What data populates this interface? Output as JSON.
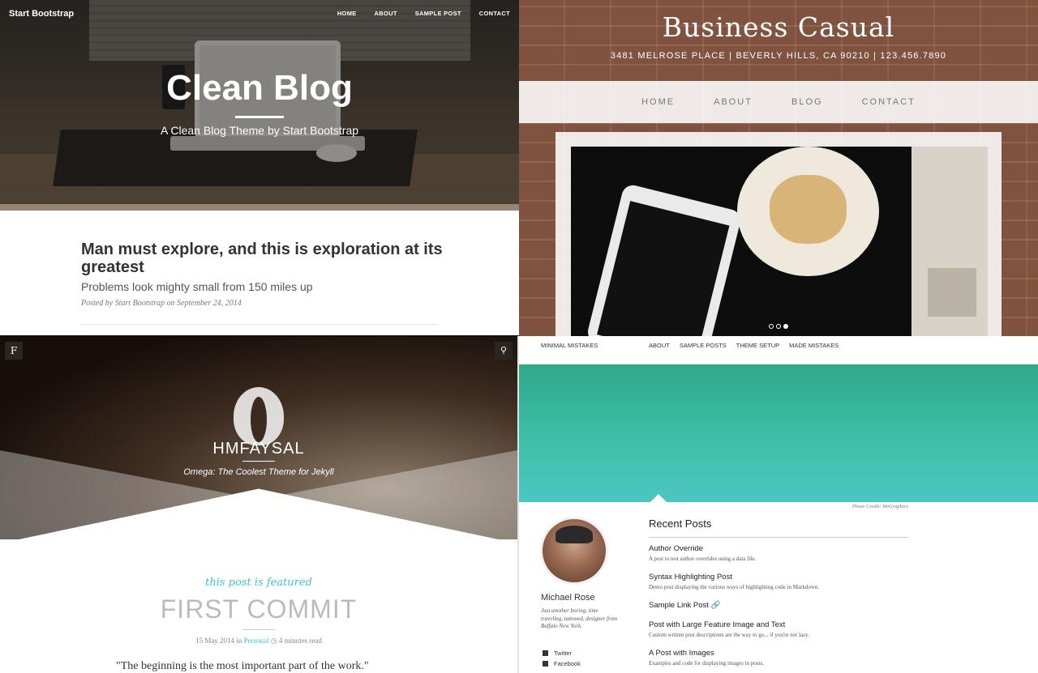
{
  "clean_blog": {
    "brand": "Start Bootstrap",
    "nav": [
      "HOME",
      "ABOUT",
      "SAMPLE POST",
      "CONTACT"
    ],
    "title": "Clean Blog",
    "subtitle": "A Clean Blog Theme by Start Bootstrap",
    "post": {
      "title": "Man must explore, and this is exploration at its greatest",
      "subtitle": "Problems look mighty small from 150 miles up",
      "meta": "Posted by Start Bootstrap on September 24, 2014"
    }
  },
  "business_casual": {
    "name": "Business Casual",
    "address": "3481 MELROSE PLACE | BEVERLY HILLS, CA 90210 | 123.456.7890",
    "nav": [
      "HOME",
      "ABOUT",
      "BLOG",
      "CONTACT"
    ],
    "carousel": {
      "slides": 3,
      "active": 3
    }
  },
  "hmfaysal": {
    "menu_button": "F",
    "search_icon": "search-icon",
    "site_name": "HMFAYSAL",
    "tagline": "Omega: The Coolest Theme for Jekyll",
    "featured_label": "this post is featured",
    "post_title": "FIRST COMMIT",
    "meta_date": "15 May 2014 in",
    "meta_category": "Personal",
    "meta_read": "4 minutes read",
    "quote": "\"The beginning is the most important part of the work.\""
  },
  "minimal_mistakes": {
    "brand": "MINIMAL MISTAKES",
    "nav": [
      "ABOUT",
      "SAMPLE POSTS",
      "THEME SETUP",
      "MADE MISTAKES"
    ],
    "photo_credit": "Photo Credit: WeGraphics",
    "author": {
      "name": "Michael Rose",
      "bio": "Just another boring, time traveling, tattooed, designer from Buffalo New York."
    },
    "social": [
      "Twitter",
      "Facebook"
    ],
    "recent_heading": "Recent Posts",
    "posts": [
      {
        "title": "Author Override",
        "desc": "A post to test author overrides using a data file."
      },
      {
        "title": "Syntax Highlighting Post",
        "desc": "Demo post displaying the various ways of highlighting code in Markdown."
      },
      {
        "title": "Sample Link Post",
        "desc": ""
      },
      {
        "title": "Post with Large Feature Image and Text",
        "desc": "Custom written post descriptions are the way to go... if you're not lazy."
      },
      {
        "title": "A Post with Images",
        "desc": "Examples and code for displaying images in posts."
      }
    ]
  },
  "colors": {
    "accent_teal": "#3ec4d0",
    "banner_green": "#3fbfa8"
  }
}
